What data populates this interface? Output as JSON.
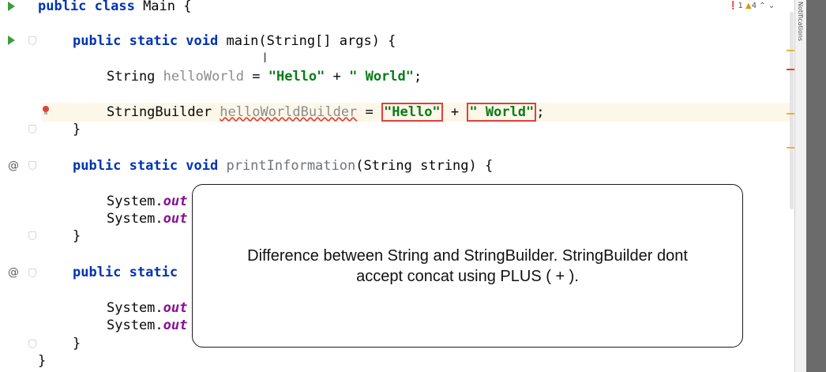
{
  "colors": {
    "keyword": "#0033b3",
    "string": "#067d17",
    "field": "#871094",
    "error": "#e0403a",
    "run": "#3f9b40"
  },
  "inspections": {
    "errors": "1",
    "warnings": "4"
  },
  "side_tab": {
    "label": "Notifications"
  },
  "code": {
    "l1": {
      "kw": "public class",
      "rest": " Main {"
    },
    "l2": {
      "kw": "public static void",
      "rest": " main(String[] args) {"
    },
    "l3": {
      "type": "String ",
      "var": "helloWorld",
      "mid": " = ",
      "s1": "\"Hello\"",
      "plus": " + ",
      "s2": "\" World\"",
      "end": ";"
    },
    "l4": {
      "type": "StringBuilder ",
      "var": "helloWorldBuilder",
      "mid": " = ",
      "s1": "\"Hello\"",
      "plus": " + ",
      "s2": "\" World\"",
      "end": ";"
    },
    "l5": "}",
    "l6": {
      "kw": "public static void",
      "fn": " printInformation",
      "rest": "(String string) {"
    },
    "l7": {
      "obj": "System.",
      "field": "out"
    },
    "l8": {
      "obj": "System.",
      "field": "out"
    },
    "l9": "}",
    "l10": {
      "kw": "public static"
    },
    "l11": {
      "obj": "System.",
      "field": "out"
    },
    "l12": {
      "obj": "System.",
      "field": "out"
    },
    "l13": "}",
    "l14": "}"
  },
  "overlay": {
    "line1": "Difference between String and StringBuilder. StringBuilder dont",
    "line2": "accept concat using PLUS ( + )."
  }
}
